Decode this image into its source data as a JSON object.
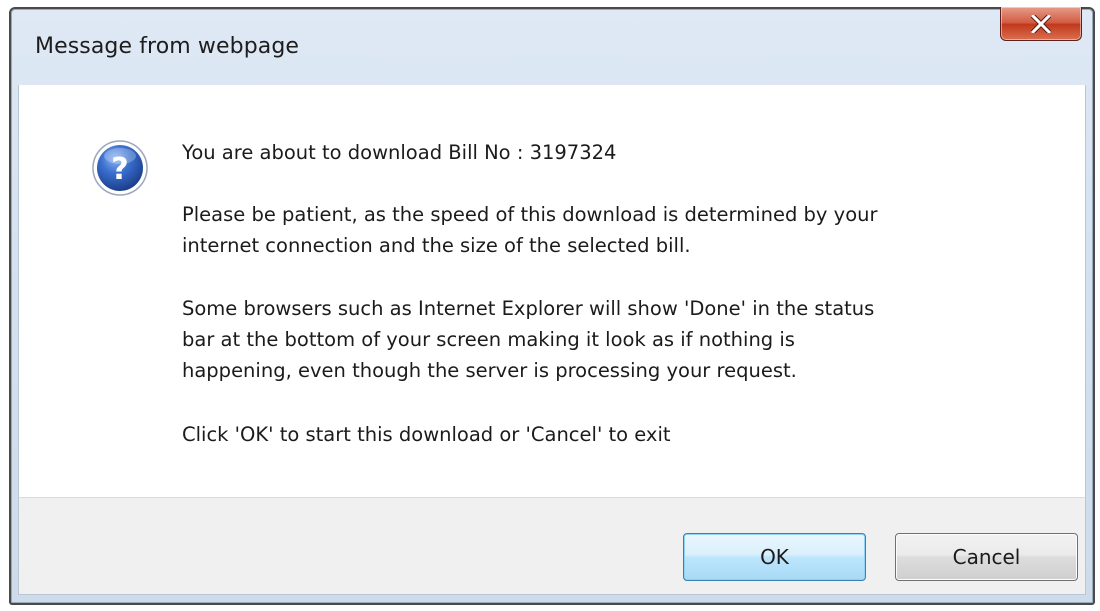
{
  "window": {
    "title": "Message from webpage"
  },
  "icons": {
    "close": "close-icon",
    "message": "question-icon"
  },
  "message": {
    "line1": "You are about to download Bill No : 3197324",
    "line2": "Please be patient, as the speed of this download is determined by your\ninternet connection and the size of the selected bill.",
    "line3": "Some browsers such as Internet Explorer will show 'Done' in the status\nbar at the bottom of your screen making it look as if nothing is\nhappening, even though the server is processing your request.",
    "line4": "Click 'OK' to start this download or 'Cancel' to exit"
  },
  "buttons": {
    "ok": "OK",
    "cancel": "Cancel"
  },
  "colors": {
    "close_button": "#c2381c",
    "ok_border": "#3c7fb1",
    "question_icon": "#2a5db8"
  }
}
